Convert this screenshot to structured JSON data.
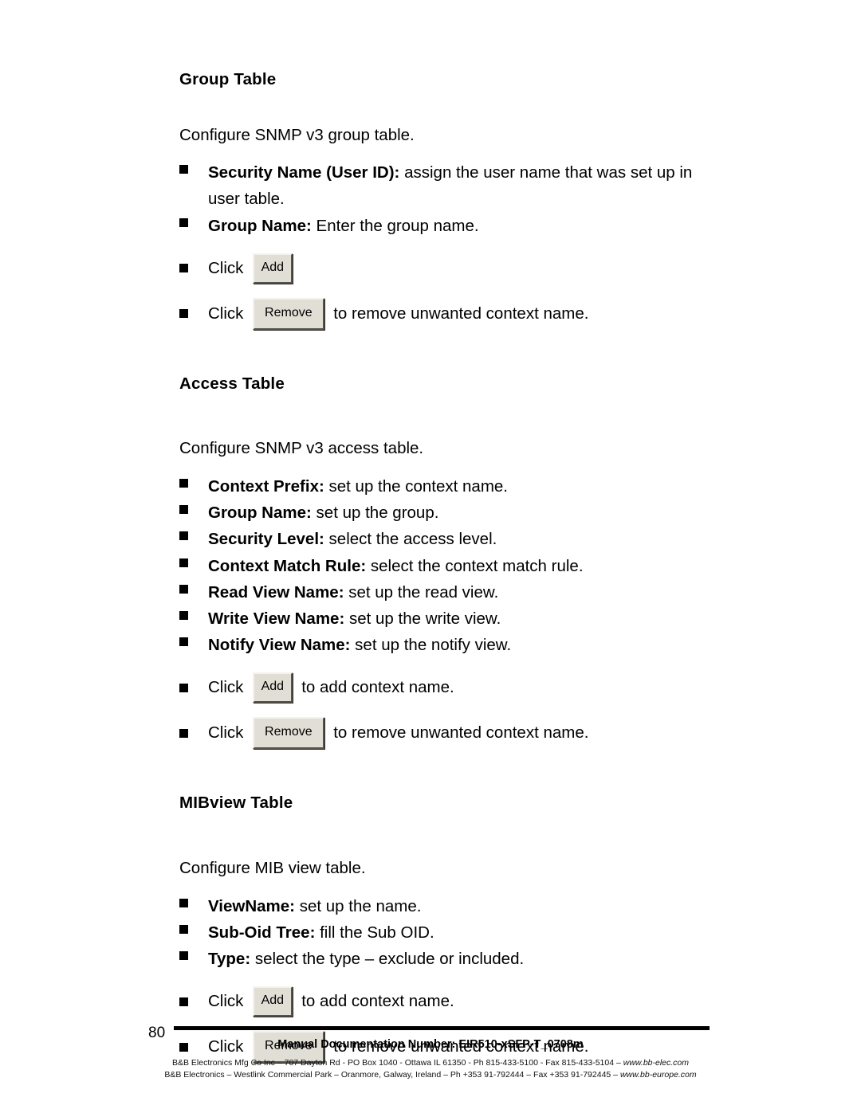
{
  "page": {
    "number": "80"
  },
  "sections": [
    {
      "heading": "Group Table",
      "intro": "Configure SNMP v3 group table.",
      "items": [
        {
          "type": "text",
          "bold": "Security Name (User ID):",
          "rest": " assign the user name that was set up in",
          "wrap": "user table."
        },
        {
          "type": "text",
          "bold": "Group Name:",
          "rest": " Enter the group name."
        },
        {
          "type": "button",
          "before": "Click",
          "button": "Add",
          "button_kind": "add",
          "after": ""
        },
        {
          "type": "button",
          "before": "Click",
          "button": "Remove",
          "button_kind": "remove",
          "after": "to remove unwanted context name."
        }
      ]
    },
    {
      "heading": "Access Table",
      "intro": "Configure SNMP v3 access table.",
      "items": [
        {
          "type": "text",
          "bold": "Context Prefix:",
          "rest": " set up the context name."
        },
        {
          "type": "text",
          "bold": "Group Name:",
          "rest": " set up the group."
        },
        {
          "type": "text",
          "bold": "Security Level:",
          "rest": " select the access level."
        },
        {
          "type": "text",
          "bold": "Context Match Rule:",
          "rest": " select the context match rule."
        },
        {
          "type": "text",
          "bold": "Read View Name:",
          "rest": " set up the read view."
        },
        {
          "type": "text",
          "bold": "Write View Name:",
          "rest": " set up the write view."
        },
        {
          "type": "text",
          "bold": "Notify View Name:",
          "rest": " set up the notify view."
        },
        {
          "type": "button",
          "before": "Click",
          "button": "Add",
          "button_kind": "add",
          "after": "to add context name."
        },
        {
          "type": "button",
          "before": "Click",
          "button": "Remove",
          "button_kind": "remove",
          "after": "to remove unwanted context name."
        }
      ]
    },
    {
      "heading": "MIBview Table",
      "intro": "Configure MIB view table.",
      "items": [
        {
          "type": "text",
          "bold": "ViewName:",
          "rest": " set up the name."
        },
        {
          "type": "text",
          "bold": "Sub-Oid Tree:",
          "rest": " fill the Sub OID."
        },
        {
          "type": "text",
          "bold": "Type:",
          "rest": " select the type – exclude or included."
        },
        {
          "type": "button",
          "before": "Click",
          "button": "Add",
          "button_kind": "add",
          "after": "to add context name."
        },
        {
          "type": "button",
          "before": "Click",
          "button": "Remove",
          "button_kind": "remove",
          "after": "to remove unwanted context name."
        }
      ]
    }
  ],
  "footer": {
    "doc_number": "Manual Documentation Number: EIR510-xSFP-T_0708m",
    "address_line_1_plain": "B&B Electronics Mfg Co Inc – 707 Dayton Rd - PO Box 1040 - Ottawa IL 61350 - Ph 815-433-5100 - Fax 815-433-5104 – ",
    "address_line_1_url": "www.bb-elec.com",
    "address_line_2_plain": "B&B Electronics – Westlink Commercial Park – Oranmore, Galway, Ireland – Ph +353 91-792444 – Fax +353 91-792445 – ",
    "address_line_2_url": "www.bb-europe.com"
  }
}
